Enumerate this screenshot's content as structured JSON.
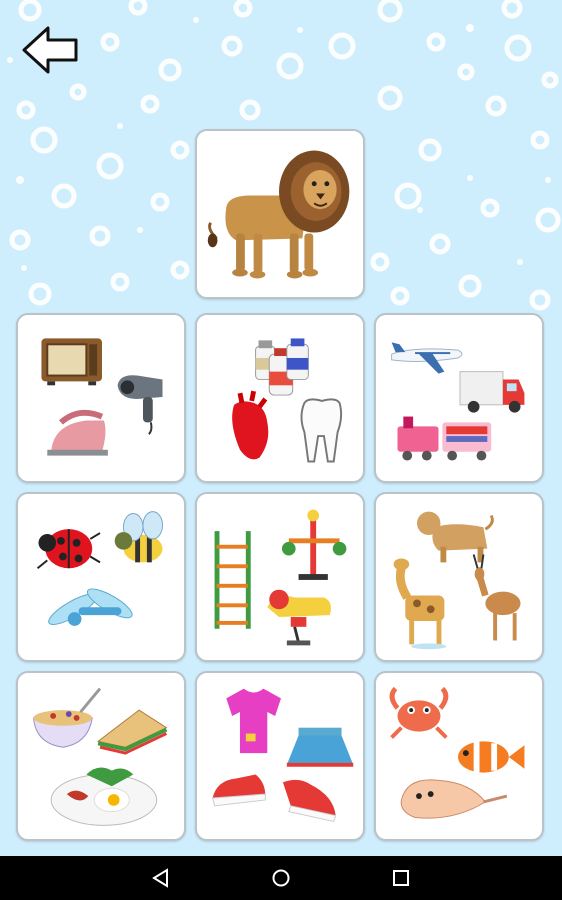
{
  "screen": "Category picker",
  "colors": {
    "background": "#cfeefd",
    "bubble": "#ffffff",
    "card_border": "#b9c3c8",
    "nav_bar": "#000000"
  },
  "header": {
    "back_icon": "back-arrow-icon"
  },
  "featured_card": {
    "content": "lion"
  },
  "category_cards": [
    {
      "id": "appliances",
      "items": [
        "microwave",
        "hair-dryer",
        "iron"
      ]
    },
    {
      "id": "body-health",
      "items": [
        "medicine-bottles",
        "heart",
        "tooth"
      ]
    },
    {
      "id": "transport",
      "items": [
        "airplane",
        "truck",
        "train"
      ]
    },
    {
      "id": "insects",
      "items": [
        "ladybug",
        "bee",
        "dragonfly"
      ]
    },
    {
      "id": "playground",
      "items": [
        "ladder",
        "carousel",
        "spring-rider"
      ]
    },
    {
      "id": "wild-animals",
      "items": [
        "lioness",
        "giraffe",
        "antelope"
      ]
    },
    {
      "id": "food",
      "items": [
        "cereal-bowl",
        "sandwich",
        "breakfast-plate"
      ]
    },
    {
      "id": "clothes",
      "items": [
        "t-shirt",
        "skirt",
        "sneakers"
      ]
    },
    {
      "id": "sea-animals",
      "items": [
        "crab",
        "clownfish",
        "seashell"
      ]
    }
  ],
  "nav_bar": {
    "back_icon": "nav-back-icon",
    "home_icon": "nav-home-icon",
    "recents_icon": "nav-recents-icon"
  }
}
